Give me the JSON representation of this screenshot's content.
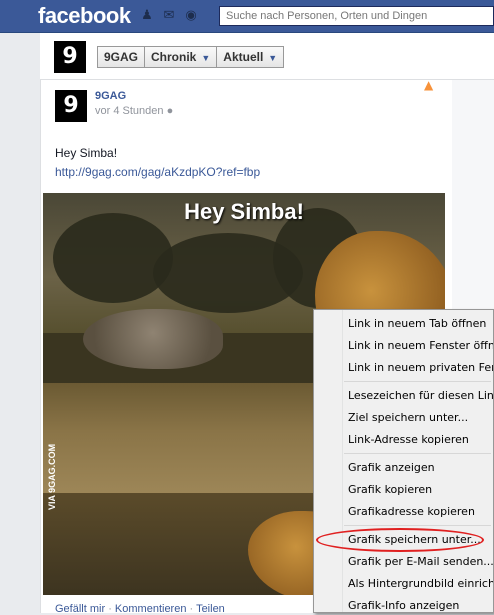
{
  "topbar": {
    "logo": "facebook",
    "search_placeholder": "Suche nach Personen, Orten und Dingen",
    "icons": [
      "friends-icon",
      "messages-icon",
      "notifications-icon"
    ]
  },
  "page_header": {
    "avatar_text": "9",
    "buttons": [
      {
        "label": "9GAG"
      },
      {
        "label": "Chronik"
      },
      {
        "label": "Aktuell"
      }
    ]
  },
  "post": {
    "author": "9GAG",
    "time": "vor 4 Stunden",
    "text": "Hey Simba!",
    "link": "http://9gag.com/gag/aKzdpKO?ref=fbp",
    "image_title": "Hey Simba!",
    "watermark": "VIA 9GAG.COM",
    "actions": {
      "like": "Gefällt mir",
      "comment": "Kommentieren",
      "share": "Teilen",
      "separator": "·"
    }
  },
  "context_menu": {
    "groups": [
      [
        "Link in neuem Tab öffnen",
        "Link in neuem Fenster öffnen",
        "Link in neuem privaten Fenster öffnen"
      ],
      [
        "Lesezeichen für diesen Link hinzufügen",
        "Ziel speichern unter...",
        "Link-Adresse kopieren"
      ],
      [
        "Grafik anzeigen",
        "Grafik kopieren",
        "Grafikadresse kopieren"
      ],
      [
        "Grafik speichern unter...",
        "Grafik per E-Mail senden...",
        "Als Hintergrundbild einrichten...",
        "Grafik-Info anzeigen"
      ]
    ]
  },
  "colors": {
    "facebook_blue": "#3b5998",
    "highlight": "#e02020"
  }
}
